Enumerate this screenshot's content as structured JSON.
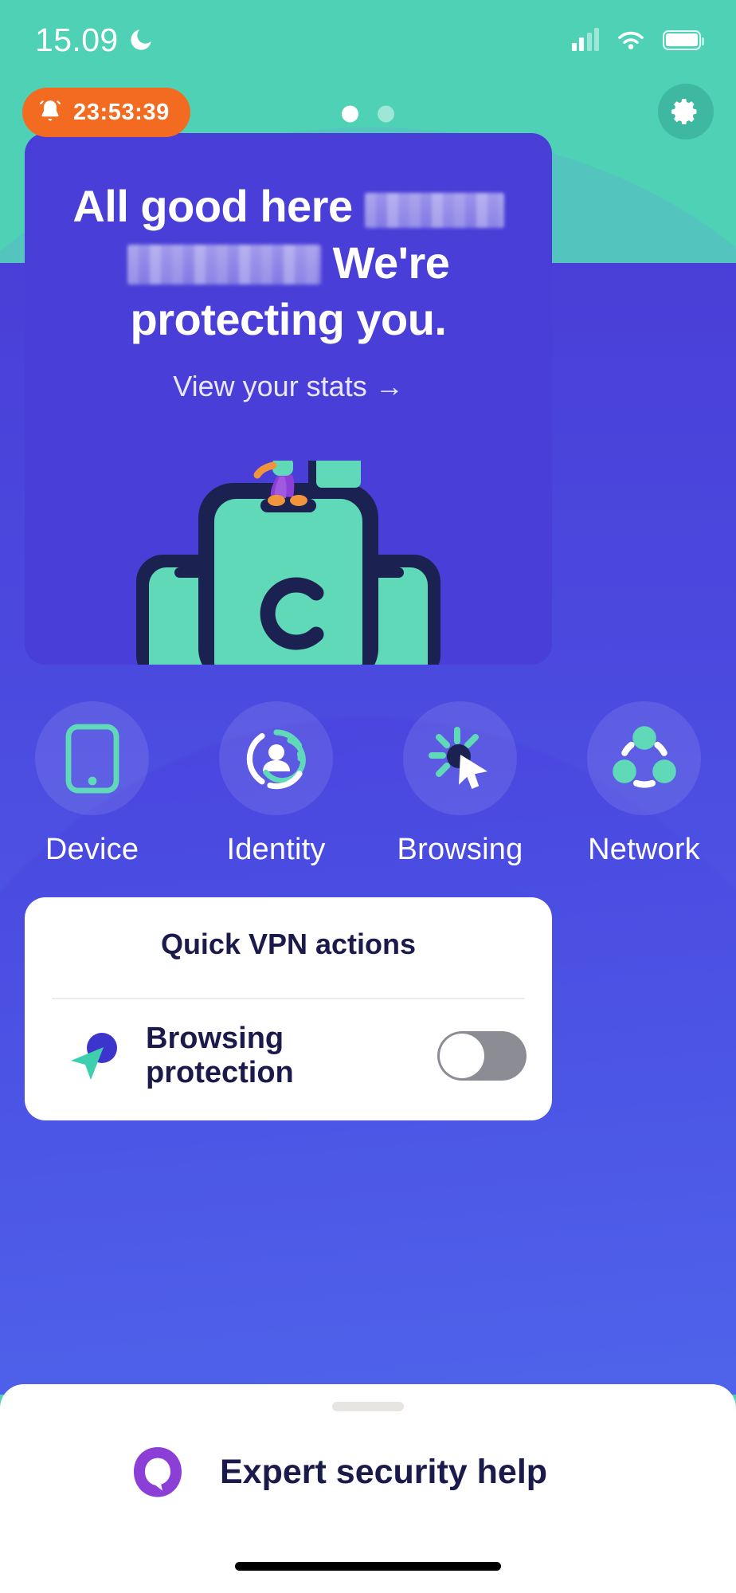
{
  "status_bar": {
    "time": "15.09",
    "moon_icon": "crescent-moon-icon",
    "signal_icon": "cellular-signal-icon",
    "wifi_icon": "wifi-icon",
    "battery_icon": "battery-full-icon"
  },
  "top_bar": {
    "timer": {
      "icon": "bell-icon",
      "value": "23:53:39"
    },
    "page_dots": {
      "count": 2,
      "active_index": 0
    },
    "settings": {
      "icon": "gear-icon",
      "label": "Settings"
    }
  },
  "hero": {
    "title_part1": "All good here",
    "redacted_1": "",
    "redacted_2": "",
    "title_part2": "We're protecting you.",
    "link_label": "View your stats",
    "link_arrow": "→",
    "illustration": "person-planting-flag-on-devices-illustration",
    "card_color": "#4a3ed8"
  },
  "categories": [
    {
      "label": "Device",
      "icon": "smartphone-icon"
    },
    {
      "label": "Identity",
      "icon": "identity-person-circle-icon"
    },
    {
      "label": "Browsing",
      "icon": "cursor-click-icon"
    },
    {
      "label": "Network",
      "icon": "network-nodes-icon"
    }
  ],
  "quick_actions": {
    "title": "Quick VPN actions",
    "rows": [
      {
        "label": "Browsing protection",
        "icon": "browsing-arrow-icon",
        "toggle_state": "off"
      }
    ]
  },
  "bottom_sheet": {
    "handle": "drag-handle",
    "label": "Expert security help",
    "icon": "chat-bubble-icon",
    "icon_color": "#8b3fd6"
  },
  "home_indicator": "home-indicator",
  "colors": {
    "teal": "#4fd1b5",
    "blue": "#4a3ed8",
    "orange": "#f26b21",
    "navy": "#1b1b4b",
    "mint": "#5fd9b8",
    "purple": "#8b3fd6",
    "toggle_off": "#8c8c94"
  }
}
